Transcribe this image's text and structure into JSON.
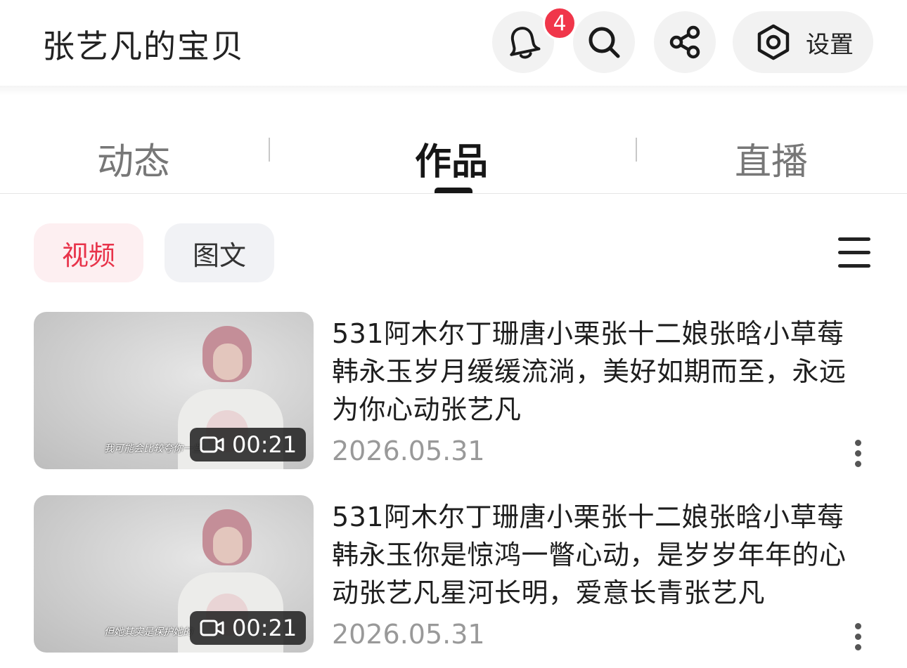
{
  "header": {
    "title": "张艺凡的宝贝",
    "notification_count": "4",
    "settings_label": "设置"
  },
  "tabs": [
    {
      "label": "动态",
      "active": false
    },
    {
      "label": "作品",
      "active": true
    },
    {
      "label": "直播",
      "active": false
    }
  ],
  "filters": [
    {
      "label": "视频",
      "active": true
    },
    {
      "label": "图文",
      "active": false
    }
  ],
  "videos": [
    {
      "description": "531阿木尔丁珊唐小栗张十二娘张晗小草莓韩永玉岁月缓缓流淌，美好如期而至，永远为你心动张艺凡",
      "date": "2026.05.31",
      "duration": "00:21",
      "subtitle": "我可能会比较夸你一些"
    },
    {
      "description": "531阿木尔丁珊唐小栗张十二娘张晗小草莓韩永玉你是惊鸿一瞥心动，是岁岁年年的心动张艺凡星河长明，爱意长青张艺凡",
      "date": "2026.05.31",
      "duration": "00:21",
      "subtitle": "但她其实是保护她的"
    }
  ],
  "colors": {
    "accent": "#e8334a",
    "badge": "#f0364a",
    "chip_active_bg": "#fdeff1",
    "chip_bg": "#f1f2f5",
    "muted_text": "#999999"
  },
  "icons": [
    "bell-icon",
    "search-icon",
    "share-icon",
    "settings-icon",
    "menu-icon",
    "video-camera-icon",
    "more-vertical-icon"
  ]
}
